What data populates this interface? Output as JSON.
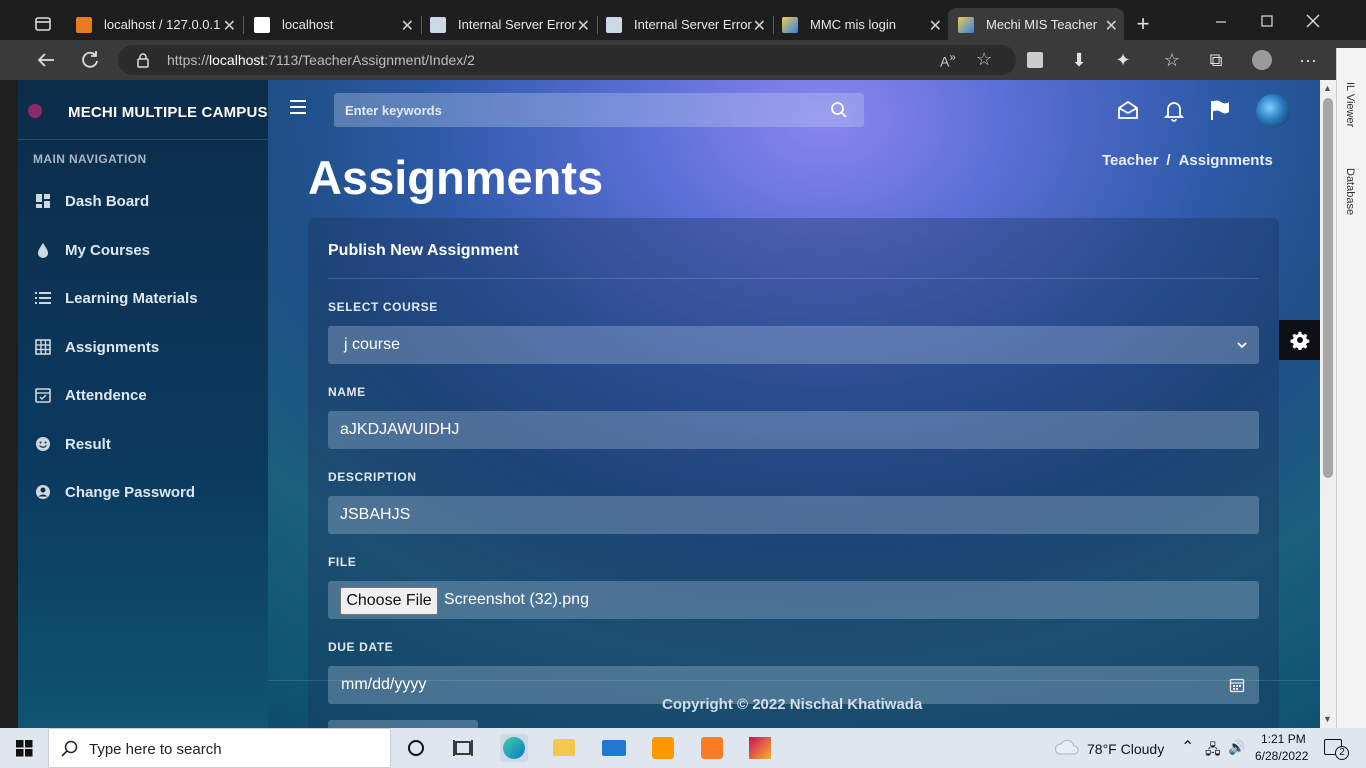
{
  "browser": {
    "tabs": [
      {
        "title": "localhost / 127.0.0.1",
        "active": false
      },
      {
        "title": "localhost",
        "active": false
      },
      {
        "title": "Internal Server Error",
        "active": false
      },
      {
        "title": "Internal Server Error",
        "active": false
      },
      {
        "title": "MMC mis login",
        "active": false
      },
      {
        "title": "Mechi MIS Teacher",
        "active": true
      }
    ],
    "url_prefix": "https://",
    "url_host": "localhost",
    "url_rest": ":7113/TeacherAssignment/Index/2"
  },
  "app": {
    "brand": "MECHI MULTIPLE CAMPUS",
    "search_placeholder": "Enter keywords",
    "nav_header": "MAIN NAVIGATION",
    "nav_items": [
      {
        "label": "Dash Board",
        "icon": "dashboard-icon"
      },
      {
        "label": "My Courses",
        "icon": "drop-icon"
      },
      {
        "label": "Learning Materials",
        "icon": "list-icon"
      },
      {
        "label": "Assignments",
        "icon": "grid-icon"
      },
      {
        "label": "Attendence",
        "icon": "calendar-check-icon"
      },
      {
        "label": "Result",
        "icon": "smile-icon"
      },
      {
        "label": "Change Password",
        "icon": "user-circle-icon"
      }
    ]
  },
  "main": {
    "page_title": "Assignments",
    "breadcrumb": [
      "Teacher",
      "Assignments"
    ],
    "breadcrumb_sep": "/",
    "form": {
      "title": "Publish New Assignment",
      "course_label": "SELECT COURSE",
      "course_value": "j course",
      "name_label": "NAME",
      "name_value": "aJKDJAWUIDHJ",
      "description_label": "DESCRIPTION",
      "description_value": "JSBAHJS",
      "file_label": "FILE",
      "file_button": "Choose File",
      "file_name": "Screenshot (32).png",
      "due_label": "DUE DATE",
      "due_value": "mm/dd/yyyy"
    },
    "footer": "Copyright © 2022 Nischal Khatiwada"
  },
  "side_panel": {
    "labels": [
      "IL Viewer",
      "Database"
    ]
  },
  "taskbar": {
    "search_text": "Type here to search",
    "weather": "78°F  Cloudy",
    "time": "1:21 PM",
    "date": "6/28/2022",
    "notifications": "2"
  }
}
